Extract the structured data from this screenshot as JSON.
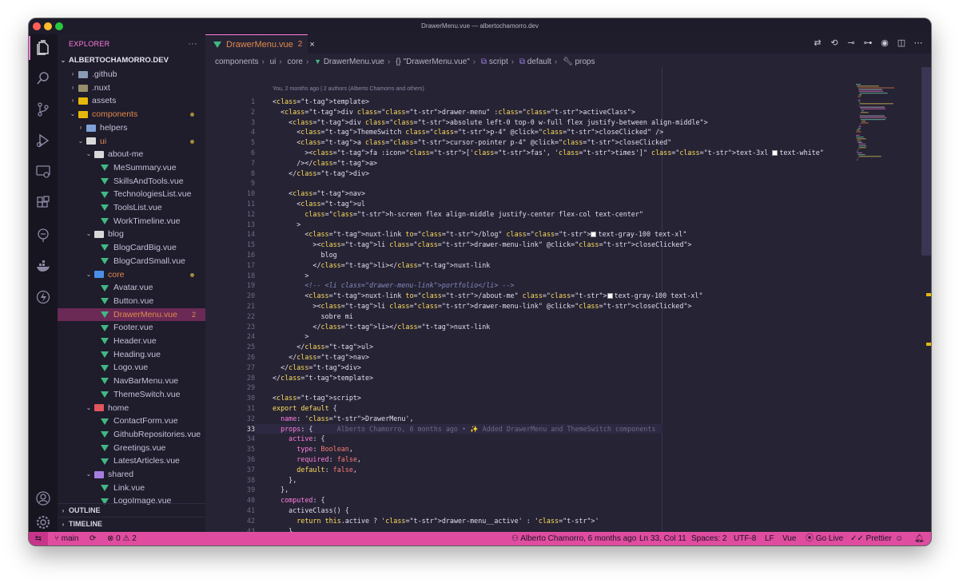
{
  "window": {
    "title": "DrawerMenu.vue — albertochamorro.dev"
  },
  "activity_bar": {
    "items": [
      "files-icon",
      "search-icon",
      "source-control-icon",
      "run-debug-icon",
      "remote-explorer-icon",
      "extensions-icon",
      "gitlens-icon",
      "docker-icon",
      "live-share-icon"
    ],
    "bottom": [
      "account-icon",
      "settings-gear-icon"
    ]
  },
  "sidebar": {
    "title": "EXPLORER",
    "more": "···",
    "root": "ALBERTOCHAMORRO.DEV",
    "tree": [
      {
        "label": ".github",
        "depth": 1,
        "kind": "folder",
        "open": false,
        "color": "#8a9bb5"
      },
      {
        "label": ".nuxt",
        "depth": 1,
        "kind": "folder",
        "open": false,
        "color": "#9a8e6a"
      },
      {
        "label": "assets",
        "depth": 1,
        "kind": "folder",
        "open": false,
        "color": "#e5b80b"
      },
      {
        "label": "components",
        "depth": 1,
        "kind": "folder",
        "open": true,
        "color": "#e5b80b",
        "dirty": true
      },
      {
        "label": "helpers",
        "depth": 2,
        "kind": "folder",
        "open": false,
        "color": "#7fa1d6"
      },
      {
        "label": "ui",
        "depth": 2,
        "kind": "folder",
        "open": true,
        "color": "#d9d9d9",
        "dirty": true
      },
      {
        "label": "about-me",
        "depth": 3,
        "kind": "folder",
        "open": true,
        "color": "#d9d9d9"
      },
      {
        "label": "MeSummary.vue",
        "depth": 4,
        "kind": "vue"
      },
      {
        "label": "SkillsAndTools.vue",
        "depth": 4,
        "kind": "vue"
      },
      {
        "label": "TechnologiesList.vue",
        "depth": 4,
        "kind": "vue"
      },
      {
        "label": "ToolsList.vue",
        "depth": 4,
        "kind": "vue"
      },
      {
        "label": "WorkTimeline.vue",
        "depth": 4,
        "kind": "vue"
      },
      {
        "label": "blog",
        "depth": 3,
        "kind": "folder",
        "open": true,
        "color": "#d9d9d9"
      },
      {
        "label": "BlogCardBig.vue",
        "depth": 4,
        "kind": "vue"
      },
      {
        "label": "BlogCardSmall.vue",
        "depth": 4,
        "kind": "vue"
      },
      {
        "label": "core",
        "depth": 3,
        "kind": "folder",
        "open": true,
        "color": "#4a8fe7",
        "dirty": true
      },
      {
        "label": "Avatar.vue",
        "depth": 4,
        "kind": "vue"
      },
      {
        "label": "Button.vue",
        "depth": 4,
        "kind": "vue"
      },
      {
        "label": "DrawerMenu.vue",
        "depth": 4,
        "kind": "vue",
        "selected": true,
        "badge": "2"
      },
      {
        "label": "Footer.vue",
        "depth": 4,
        "kind": "vue"
      },
      {
        "label": "Header.vue",
        "depth": 4,
        "kind": "vue"
      },
      {
        "label": "Heading.vue",
        "depth": 4,
        "kind": "vue"
      },
      {
        "label": "Logo.vue",
        "depth": 4,
        "kind": "vue"
      },
      {
        "label": "NavBarMenu.vue",
        "depth": 4,
        "kind": "vue"
      },
      {
        "label": "ThemeSwitch.vue",
        "depth": 4,
        "kind": "vue"
      },
      {
        "label": "home",
        "depth": 3,
        "kind": "folder",
        "open": true,
        "color": "#e0565b"
      },
      {
        "label": "ContactForm.vue",
        "depth": 4,
        "kind": "vue"
      },
      {
        "label": "GithubRepositories.vue",
        "depth": 4,
        "kind": "vue"
      },
      {
        "label": "Greetings.vue",
        "depth": 4,
        "kind": "vue"
      },
      {
        "label": "LatestArticles.vue",
        "depth": 4,
        "kind": "vue"
      },
      {
        "label": "shared",
        "depth": 3,
        "kind": "folder",
        "open": true,
        "color": "#a67ee0"
      },
      {
        "label": "Link.vue",
        "depth": 4,
        "kind": "vue"
      },
      {
        "label": "LogoImage.vue",
        "depth": 4,
        "kind": "vue"
      }
    ],
    "sections": [
      "OUTLINE",
      "TIMELINE"
    ]
  },
  "editor": {
    "tab": {
      "label": "DrawerMenu.vue",
      "count": "2",
      "close": "×"
    },
    "breadcrumbs": [
      "components",
      "ui",
      "core",
      "DrawerMenu.vue",
      "{} \"DrawerMenu.vue\"",
      "script",
      "default",
      "props"
    ],
    "blame_header": "You, 2 months ago | 2 authors (Alberto Chamorro and others)",
    "current_line": 33,
    "inline_blame": "Alberto Chamorro, 6 months ago • ✨ Added DrawerMenu and ThemeSwitch components",
    "lines": [
      "<template>",
      "  <div class=\"drawer-menu\" :class=\"activeClass\">",
      "    <div class=\"absolute left-0 top-0 w-full flex justify-between align-middle\">",
      "      <ThemeSwitch class=\"p-4\" @click=\"closeClicked\" />",
      "      <a class=\"cursor-pointer p-4\" @click=\"closeClicked\"",
      "        ><fa :icon=\"['fas', 'times']\" class=\"text-3xl ■text-white\"",
      "      /></a>",
      "    </div>",
      "",
      "    <nav>",
      "      <ul",
      "        class=\"h-screen flex align-middle justify-center flex-col text-center\"",
      "      >",
      "        <nuxt-link to=\"/blog\" class=\"■text-gray-100 text-xl\"",
      "          ><li class=\"drawer-menu-link\" @click=\"closeClicked\">",
      "            blog",
      "          </li></nuxt-link",
      "        >",
      "        <!-- <li class=\"drawer-menu-link\">portfolio</li> -->",
      "        <nuxt-link to=\"/about-me\" class=\"■text-gray-100 text-xl\"",
      "          ><li class=\"drawer-menu-link\" @click=\"closeClicked\">",
      "            sobre mi",
      "          </li></nuxt-link",
      "        >",
      "      </ul>",
      "    </nav>",
      "  </div>",
      "</template>",
      "",
      "<script>",
      "export default {",
      "  name: 'DrawerMenu',",
      "  props: {",
      "    active: {",
      "      type: Boolean,",
      "      required: false,",
      "      default: false,",
      "    },",
      "  },",
      "  computed: {",
      "    activeClass() {",
      "      return this.active ? 'drawer-menu__active' : ''",
      "    },",
      "  },"
    ]
  },
  "statusbar": {
    "branch": "main",
    "errors": "0",
    "warnings": "2",
    "blame": "Alberto Chamorro, 6 months ago",
    "position": "Ln 33, Col 11",
    "spaces": "Spaces: 2",
    "encoding": "UTF-8",
    "eol": "LF",
    "language": "Vue",
    "golive": "Go Live",
    "prettier": "Prettier"
  },
  "colors": {
    "accent": "#ff7edb",
    "statusbar": "#e04ca0",
    "editor_bg": "#262335",
    "sidebar_bg": "#1f1c2c",
    "selection": "#6b2a55"
  }
}
